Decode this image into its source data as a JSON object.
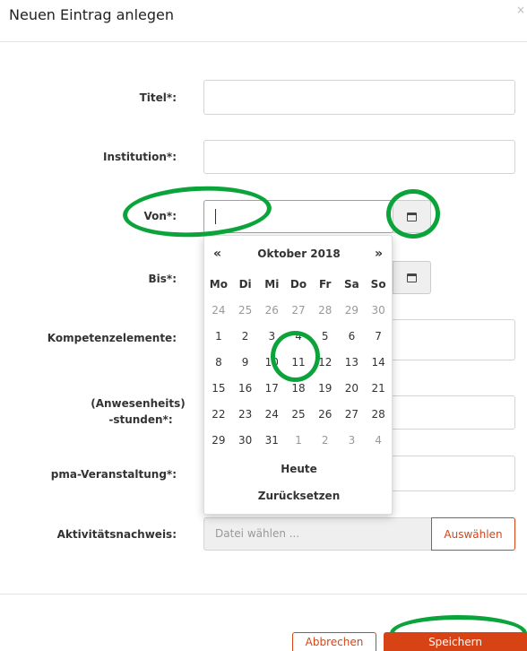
{
  "modal": {
    "title": "Neuen Eintrag anlegen",
    "close_icon": "×"
  },
  "form": {
    "titel_label": "Titel*:",
    "titel_value": "",
    "institution_label": "Institution*:",
    "institution_value": "",
    "von_label": "Von*:",
    "von_value": "",
    "bis_label": "Bis*:",
    "kompetenz_label": "Kompetenzelemente:",
    "anwesenheit_label_1": "(Anwesenheits)",
    "anwesenheit_label_2": "-stunden*:",
    "pma_label": "pma-Veranstaltung*:",
    "aktivitaet_label": "Aktivitätsnachweis:",
    "file_placeholder": "Datei wählen ...",
    "file_button": "Auswählen"
  },
  "datepicker": {
    "prev": "«",
    "next": "»",
    "month_label": "Oktober 2018",
    "weekdays": [
      "Mo",
      "Di",
      "Mi",
      "Do",
      "Fr",
      "Sa",
      "So"
    ],
    "weeks": [
      [
        {
          "d": "24",
          "old": true
        },
        {
          "d": "25",
          "old": true
        },
        {
          "d": "26",
          "old": true
        },
        {
          "d": "27",
          "old": true
        },
        {
          "d": "28",
          "old": true
        },
        {
          "d": "29",
          "old": true
        },
        {
          "d": "30",
          "old": true
        }
      ],
      [
        {
          "d": "1"
        },
        {
          "d": "2"
        },
        {
          "d": "3"
        },
        {
          "d": "4"
        },
        {
          "d": "5"
        },
        {
          "d": "6"
        },
        {
          "d": "7"
        }
      ],
      [
        {
          "d": "8"
        },
        {
          "d": "9"
        },
        {
          "d": "10"
        },
        {
          "d": "11"
        },
        {
          "d": "12"
        },
        {
          "d": "13"
        },
        {
          "d": "14"
        }
      ],
      [
        {
          "d": "15"
        },
        {
          "d": "16"
        },
        {
          "d": "17"
        },
        {
          "d": "18"
        },
        {
          "d": "19"
        },
        {
          "d": "20"
        },
        {
          "d": "21"
        }
      ],
      [
        {
          "d": "22"
        },
        {
          "d": "23"
        },
        {
          "d": "24"
        },
        {
          "d": "25"
        },
        {
          "d": "26"
        },
        {
          "d": "27"
        },
        {
          "d": "28"
        }
      ],
      [
        {
          "d": "29"
        },
        {
          "d": "30"
        },
        {
          "d": "31"
        },
        {
          "d": "1",
          "old": true
        },
        {
          "d": "2",
          "old": true
        },
        {
          "d": "3",
          "old": true
        },
        {
          "d": "4",
          "old": true
        }
      ]
    ],
    "today_label": "Heute",
    "reset_label": "Zurücksetzen"
  },
  "footer": {
    "cancel_label": "Abbrechen",
    "save_label": "Speichern"
  },
  "colors": {
    "accent": "#d84315",
    "highlight_ring": "#0aa43a"
  }
}
